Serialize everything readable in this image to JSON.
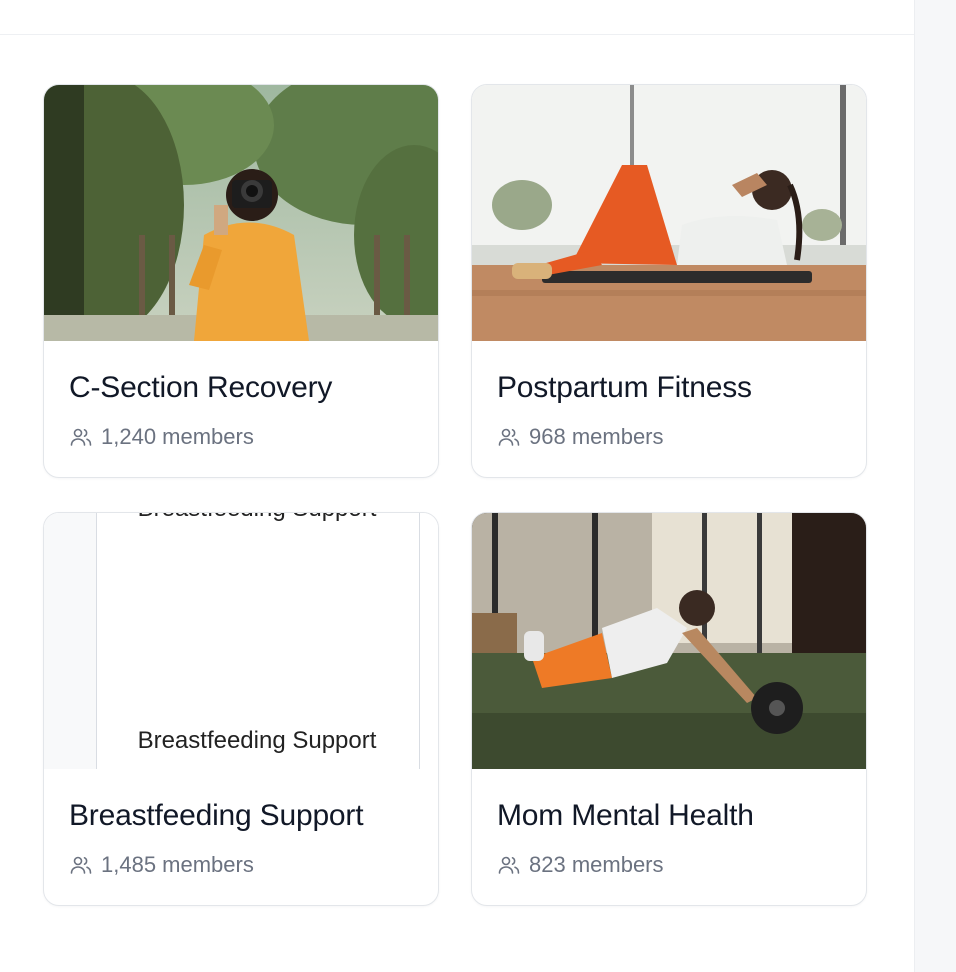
{
  "groups": [
    {
      "title": "C-Section Recovery",
      "members": "1,240 members",
      "image": "photographer-photo"
    },
    {
      "title": "Postpartum Fitness",
      "members": "968 members",
      "image": "crunches-photo"
    },
    {
      "title": "Breastfeeding Support",
      "members": "1,485 members",
      "image": "broken-image",
      "alt": "Breastfeeding Support"
    },
    {
      "title": "Mom Mental Health",
      "members": "823 members",
      "image": "ab-roller-photo"
    }
  ],
  "icons": {
    "members": "users-icon"
  },
  "colors": {
    "title": "#111827",
    "meta": "#6b7280",
    "border": "#e3e6ea"
  }
}
